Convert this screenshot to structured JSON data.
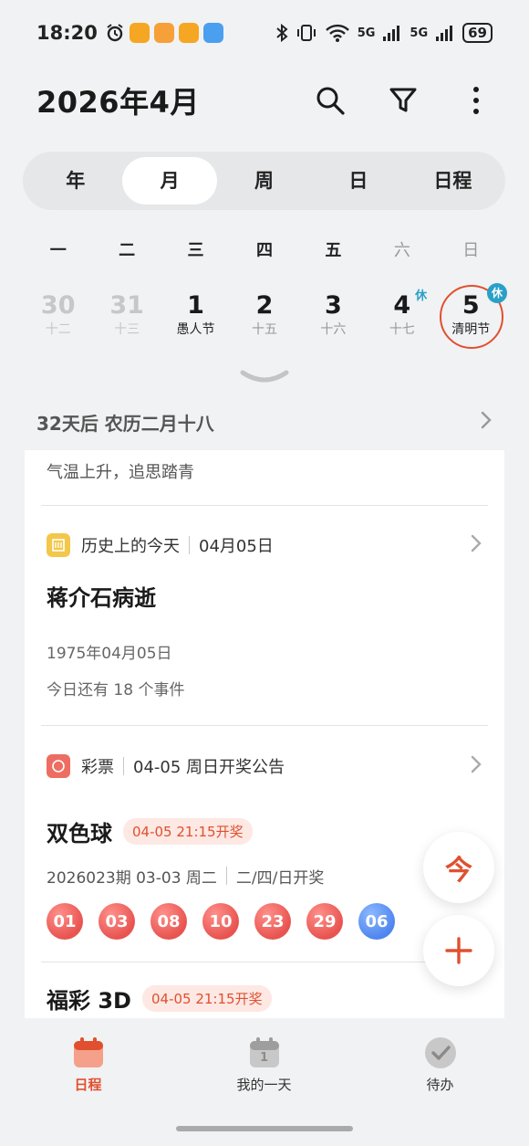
{
  "status_bar": {
    "time": "18:20",
    "battery": "69",
    "net1": "5G",
    "net2": "5G"
  },
  "header": {
    "title": "2026年4月"
  },
  "tabs": [
    {
      "label": "年"
    },
    {
      "label": "月",
      "active": true
    },
    {
      "label": "周"
    },
    {
      "label": "日"
    },
    {
      "label": "日程"
    }
  ],
  "weekdays": [
    "一",
    "二",
    "三",
    "四",
    "五",
    "六",
    "日"
  ],
  "dates": [
    {
      "num": "30",
      "sub": "十二",
      "faded": true
    },
    {
      "num": "31",
      "sub": "十三",
      "faded": true
    },
    {
      "num": "1",
      "sub": "愚人节",
      "holiday": true
    },
    {
      "num": "2",
      "sub": "十五"
    },
    {
      "num": "3",
      "sub": "十六"
    },
    {
      "num": "4",
      "sub": "十七",
      "rest": "休"
    },
    {
      "num": "5",
      "sub": "清明节",
      "holiday": true,
      "selected": true,
      "rest": "休"
    }
  ],
  "info": {
    "text": "32天后 农历二月十八"
  },
  "content": {
    "description": "气温上升，追思踏青",
    "history": {
      "source": "历史上的今天",
      "date": "04月05日",
      "title": "蒋介石病逝",
      "event_date": "1975年04月05日",
      "count_text": "今日还有 18 个事件"
    },
    "lottery": {
      "source": "彩票",
      "meta": "04-05 周日开奖公告",
      "name": "双色球",
      "chip": "04-05 21:15开奖",
      "issue": "2026023期 03-03 周二",
      "schedule": "二/四/日开奖",
      "red_balls": [
        "01",
        "03",
        "08",
        "10",
        "23",
        "29"
      ],
      "blue_ball": "06",
      "next_name": "福彩 3D",
      "next_chip": "04-05 21:15开奖"
    }
  },
  "fab": {
    "today": "今"
  },
  "bottom_nav": [
    {
      "label": "日程",
      "active": true
    },
    {
      "label": "我的一天",
      "day": "1"
    },
    {
      "label": "待办"
    }
  ],
  "colors": {
    "accent": "#e0502f",
    "rest": "#2aa0c8"
  }
}
